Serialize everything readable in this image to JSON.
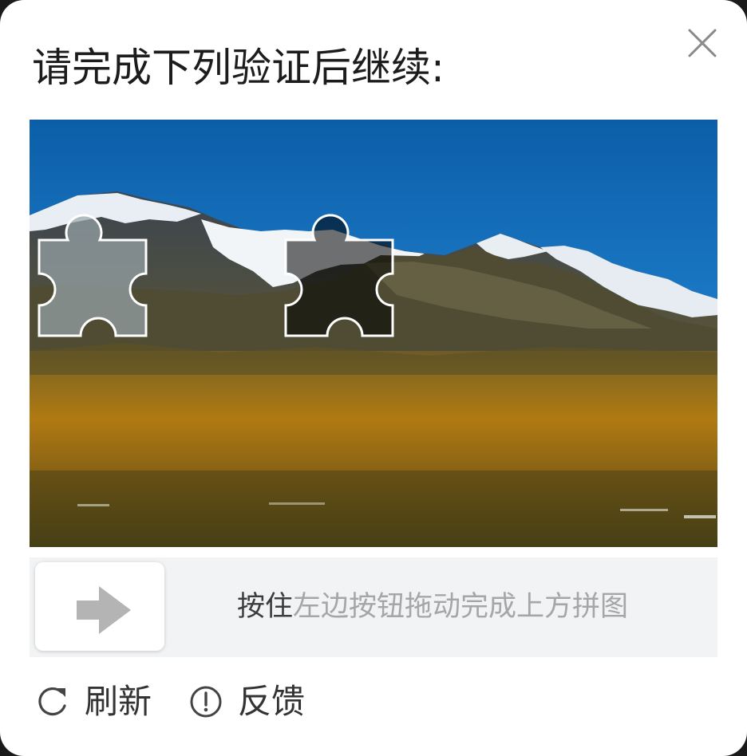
{
  "dialog": {
    "title": "请完成下列验证后继续:",
    "close_icon": "close-icon"
  },
  "puzzle": {
    "scene": "snow-capped mountains above golden grassland under blue sky",
    "piece_icon": "puzzle-piece-icon",
    "gap_icon": "puzzle-gap-icon"
  },
  "slider": {
    "handle_icon": "arrow-right-icon",
    "hint_part1": "按住",
    "hint_part2": "左边按钮拖动完成上方拼图",
    "colors": {
      "track": "#f2f3f5",
      "handle": "#ffffff",
      "arrow": "#b4b4b4"
    }
  },
  "footer": {
    "refresh_label": "刷新",
    "refresh_icon": "refresh-icon",
    "feedback_label": "反馈",
    "feedback_icon": "info-circle-icon"
  }
}
